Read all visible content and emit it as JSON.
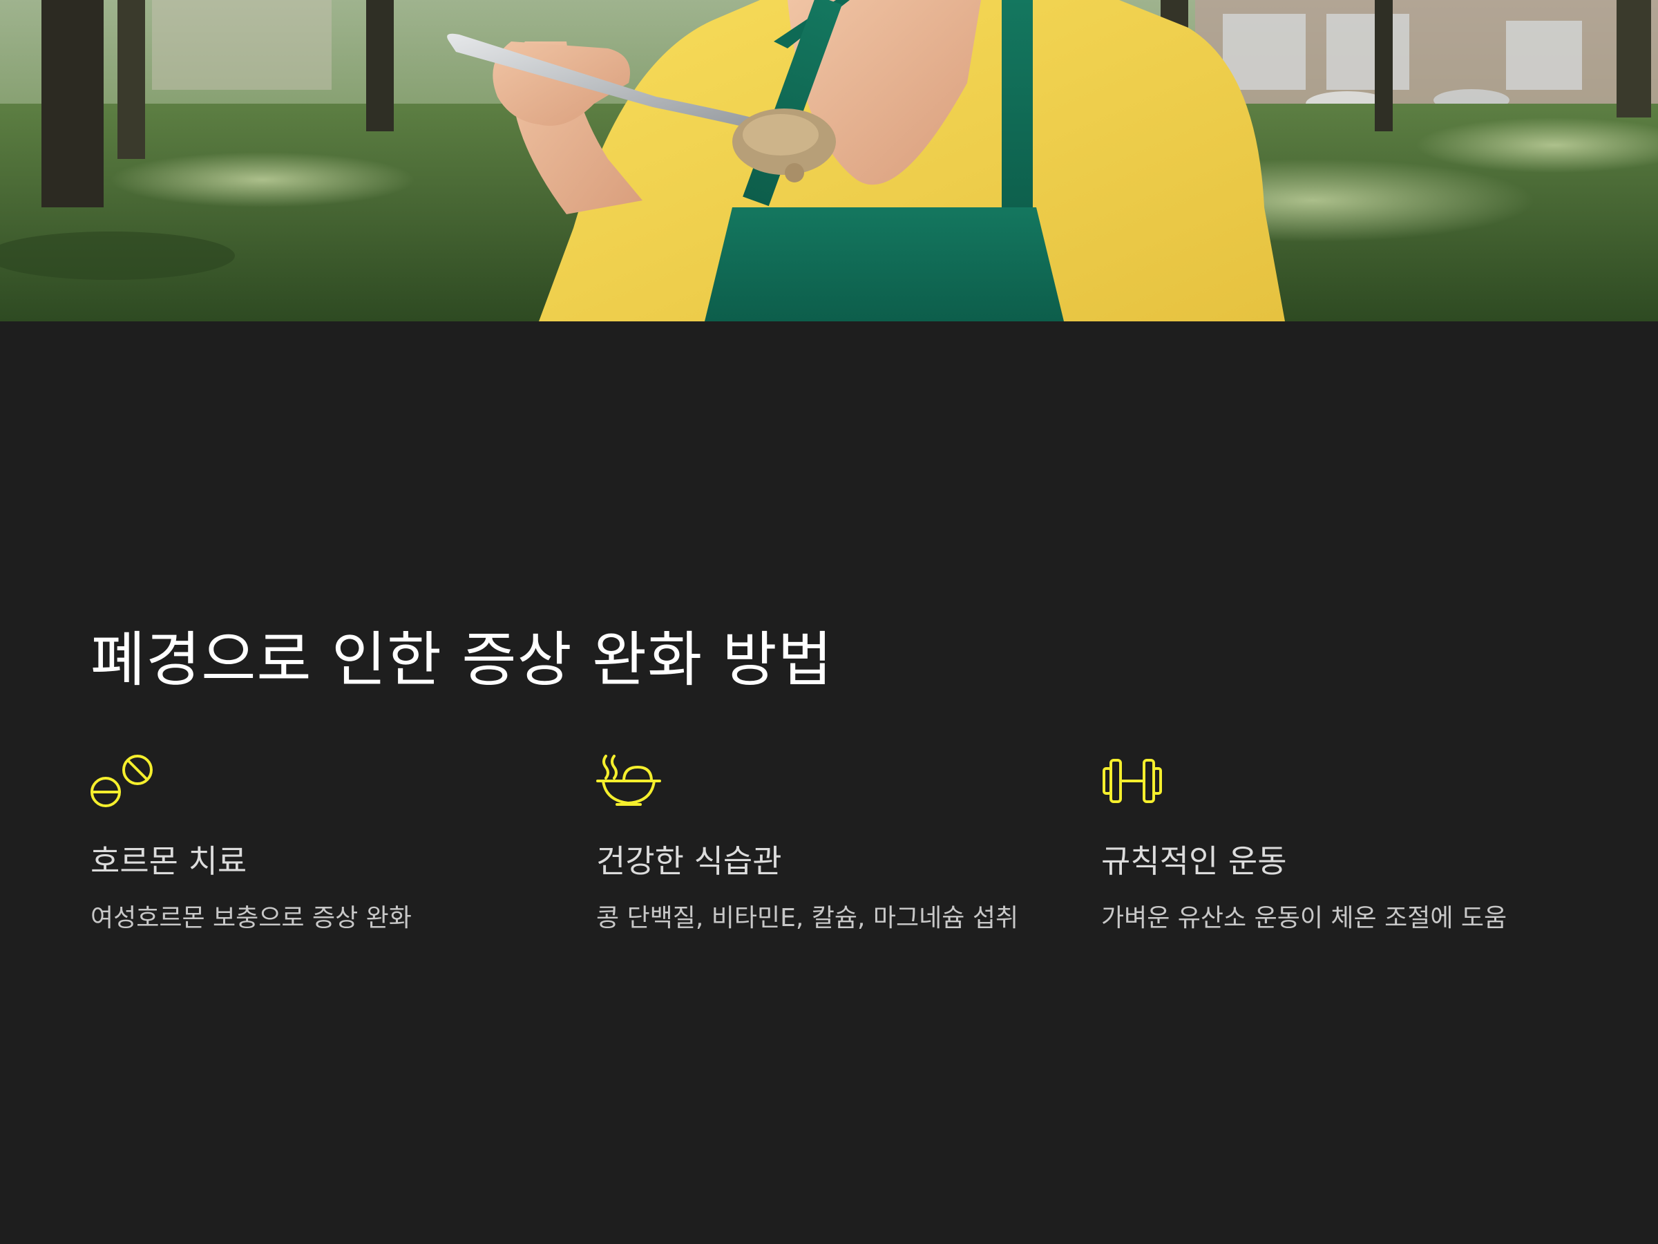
{
  "hero": {
    "icon": "woman-eating-with-fork-photo"
  },
  "title": "폐경으로 인한 증상 완화 방법",
  "accent_color": "#f5ef2d",
  "background_color": "#1e1e1e",
  "features": [
    {
      "icon": "pill-icon",
      "title": "호르몬 치료",
      "description": "여성호르몬 보충으로 증상 완화"
    },
    {
      "icon": "bowl-icon",
      "title": "건강한 식습관",
      "description": "콩 단백질, 비타민E, 칼슘, 마그네슘 섭취"
    },
    {
      "icon": "dumbbell-icon",
      "title": "규칙적인 운동",
      "description": "가벼운 유산소 운동이 체온 조절에 도움"
    }
  ]
}
